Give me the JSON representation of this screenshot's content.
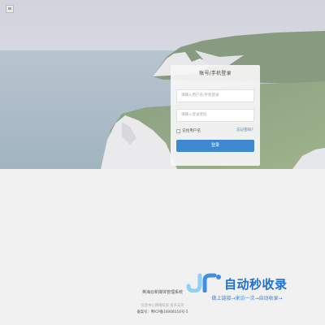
{
  "login": {
    "title": "账号/手机登录",
    "username_placeholder": "请输入用户名/手机登录",
    "password_placeholder": "请输入登录密码",
    "remember_label": "记住用户名",
    "forgot_label": "忘记密码？",
    "submit_label": "登录"
  },
  "footer": {
    "system_name": "英海云新媒体管理系统",
    "support_text": "信息中心网络科技 技术支持",
    "icp_text": "备案号：粤ICP备16008116号-5"
  },
  "watermark": {
    "title": "自动秒收录",
    "subtitle": "做上链接→来访一次→自动收录→"
  },
  "icons": {
    "broken_image": "broken-image-icon",
    "watermark_logo": "jr-logo-icon"
  },
  "colors": {
    "accent": "#3d88cf",
    "link": "#3b86d1",
    "watermark": "#1f6fd1"
  }
}
